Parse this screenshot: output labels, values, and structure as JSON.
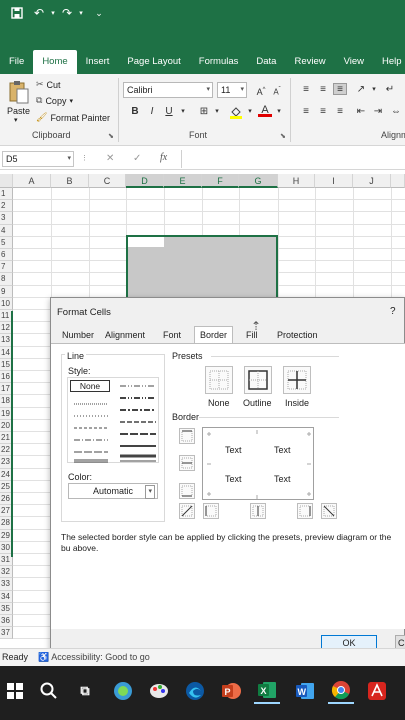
{
  "quick_access": {
    "save_icon": "save-icon",
    "undo_icon": "undo-icon",
    "redo_icon": "redo-icon"
  },
  "tabs": [
    {
      "label": "File"
    },
    {
      "label": "Home"
    },
    {
      "label": "Insert"
    },
    {
      "label": "Page Layout"
    },
    {
      "label": "Formulas"
    },
    {
      "label": "Data"
    },
    {
      "label": "Review"
    },
    {
      "label": "View"
    },
    {
      "label": "Help"
    }
  ],
  "ribbon": {
    "paste": "Paste",
    "cut": "Cut",
    "copy": "Copy",
    "format_painter": "Format Painter",
    "clipboard": "Clipboard",
    "font_name": "Calibri",
    "font_size": "11",
    "bold": "B",
    "italic": "I",
    "underline": "U",
    "font_group": "Font",
    "alignment_group": "Alignm"
  },
  "formula_bar": {
    "name_box": "D5",
    "fx": "fx",
    "cancel": "✕",
    "enter": "✓"
  },
  "columns": [
    "A",
    "B",
    "C",
    "D",
    "E",
    "F",
    "G",
    "H",
    "I",
    "J"
  ],
  "rows": [
    "1",
    "2",
    "3",
    "4",
    "5",
    "6",
    "7",
    "8",
    "9",
    "10",
    "11",
    "12",
    "13",
    "14",
    "15",
    "16",
    "17",
    "18",
    "19",
    "20",
    "21",
    "22",
    "23",
    "24",
    "25",
    "26",
    "27",
    "28",
    "29",
    "30",
    "31",
    "32",
    "33",
    "34",
    "35",
    "36",
    "37"
  ],
  "dialog": {
    "title": "Format Cells",
    "help": "?",
    "tabs": [
      "Number",
      "Alignment",
      "Font",
      "Border",
      "Fill",
      "Protection"
    ],
    "line_label": "Line",
    "style_label": "Style:",
    "none_style": "None",
    "color_label": "Color:",
    "color_value": "Automatic",
    "presets_label": "Presets",
    "preset_none": "None",
    "preset_outline": "Outline",
    "preset_inside": "Inside",
    "border_label": "Border",
    "preview_text": [
      "Text",
      "Text",
      "Text",
      "Text"
    ],
    "info": "The selected border style can be applied by clicking the presets, preview diagram or the bu above.",
    "ok": "OK",
    "cancel": "C"
  },
  "status": {
    "ready": "Ready",
    "accessibility": "Accessibility: Good to go"
  },
  "taskbar": {
    "icons": [
      "windows-icon",
      "search-icon",
      "task-view-icon",
      "edge-dev-icon",
      "paint-icon",
      "edge-icon",
      "powerpoint-icon",
      "excel-icon",
      "word-icon",
      "chrome-icon",
      "acrobat-icon"
    ]
  },
  "colors": {
    "excel_green": "#1e7145",
    "selection": "#c8c8c8",
    "ok_blue": "#0078d4"
  }
}
